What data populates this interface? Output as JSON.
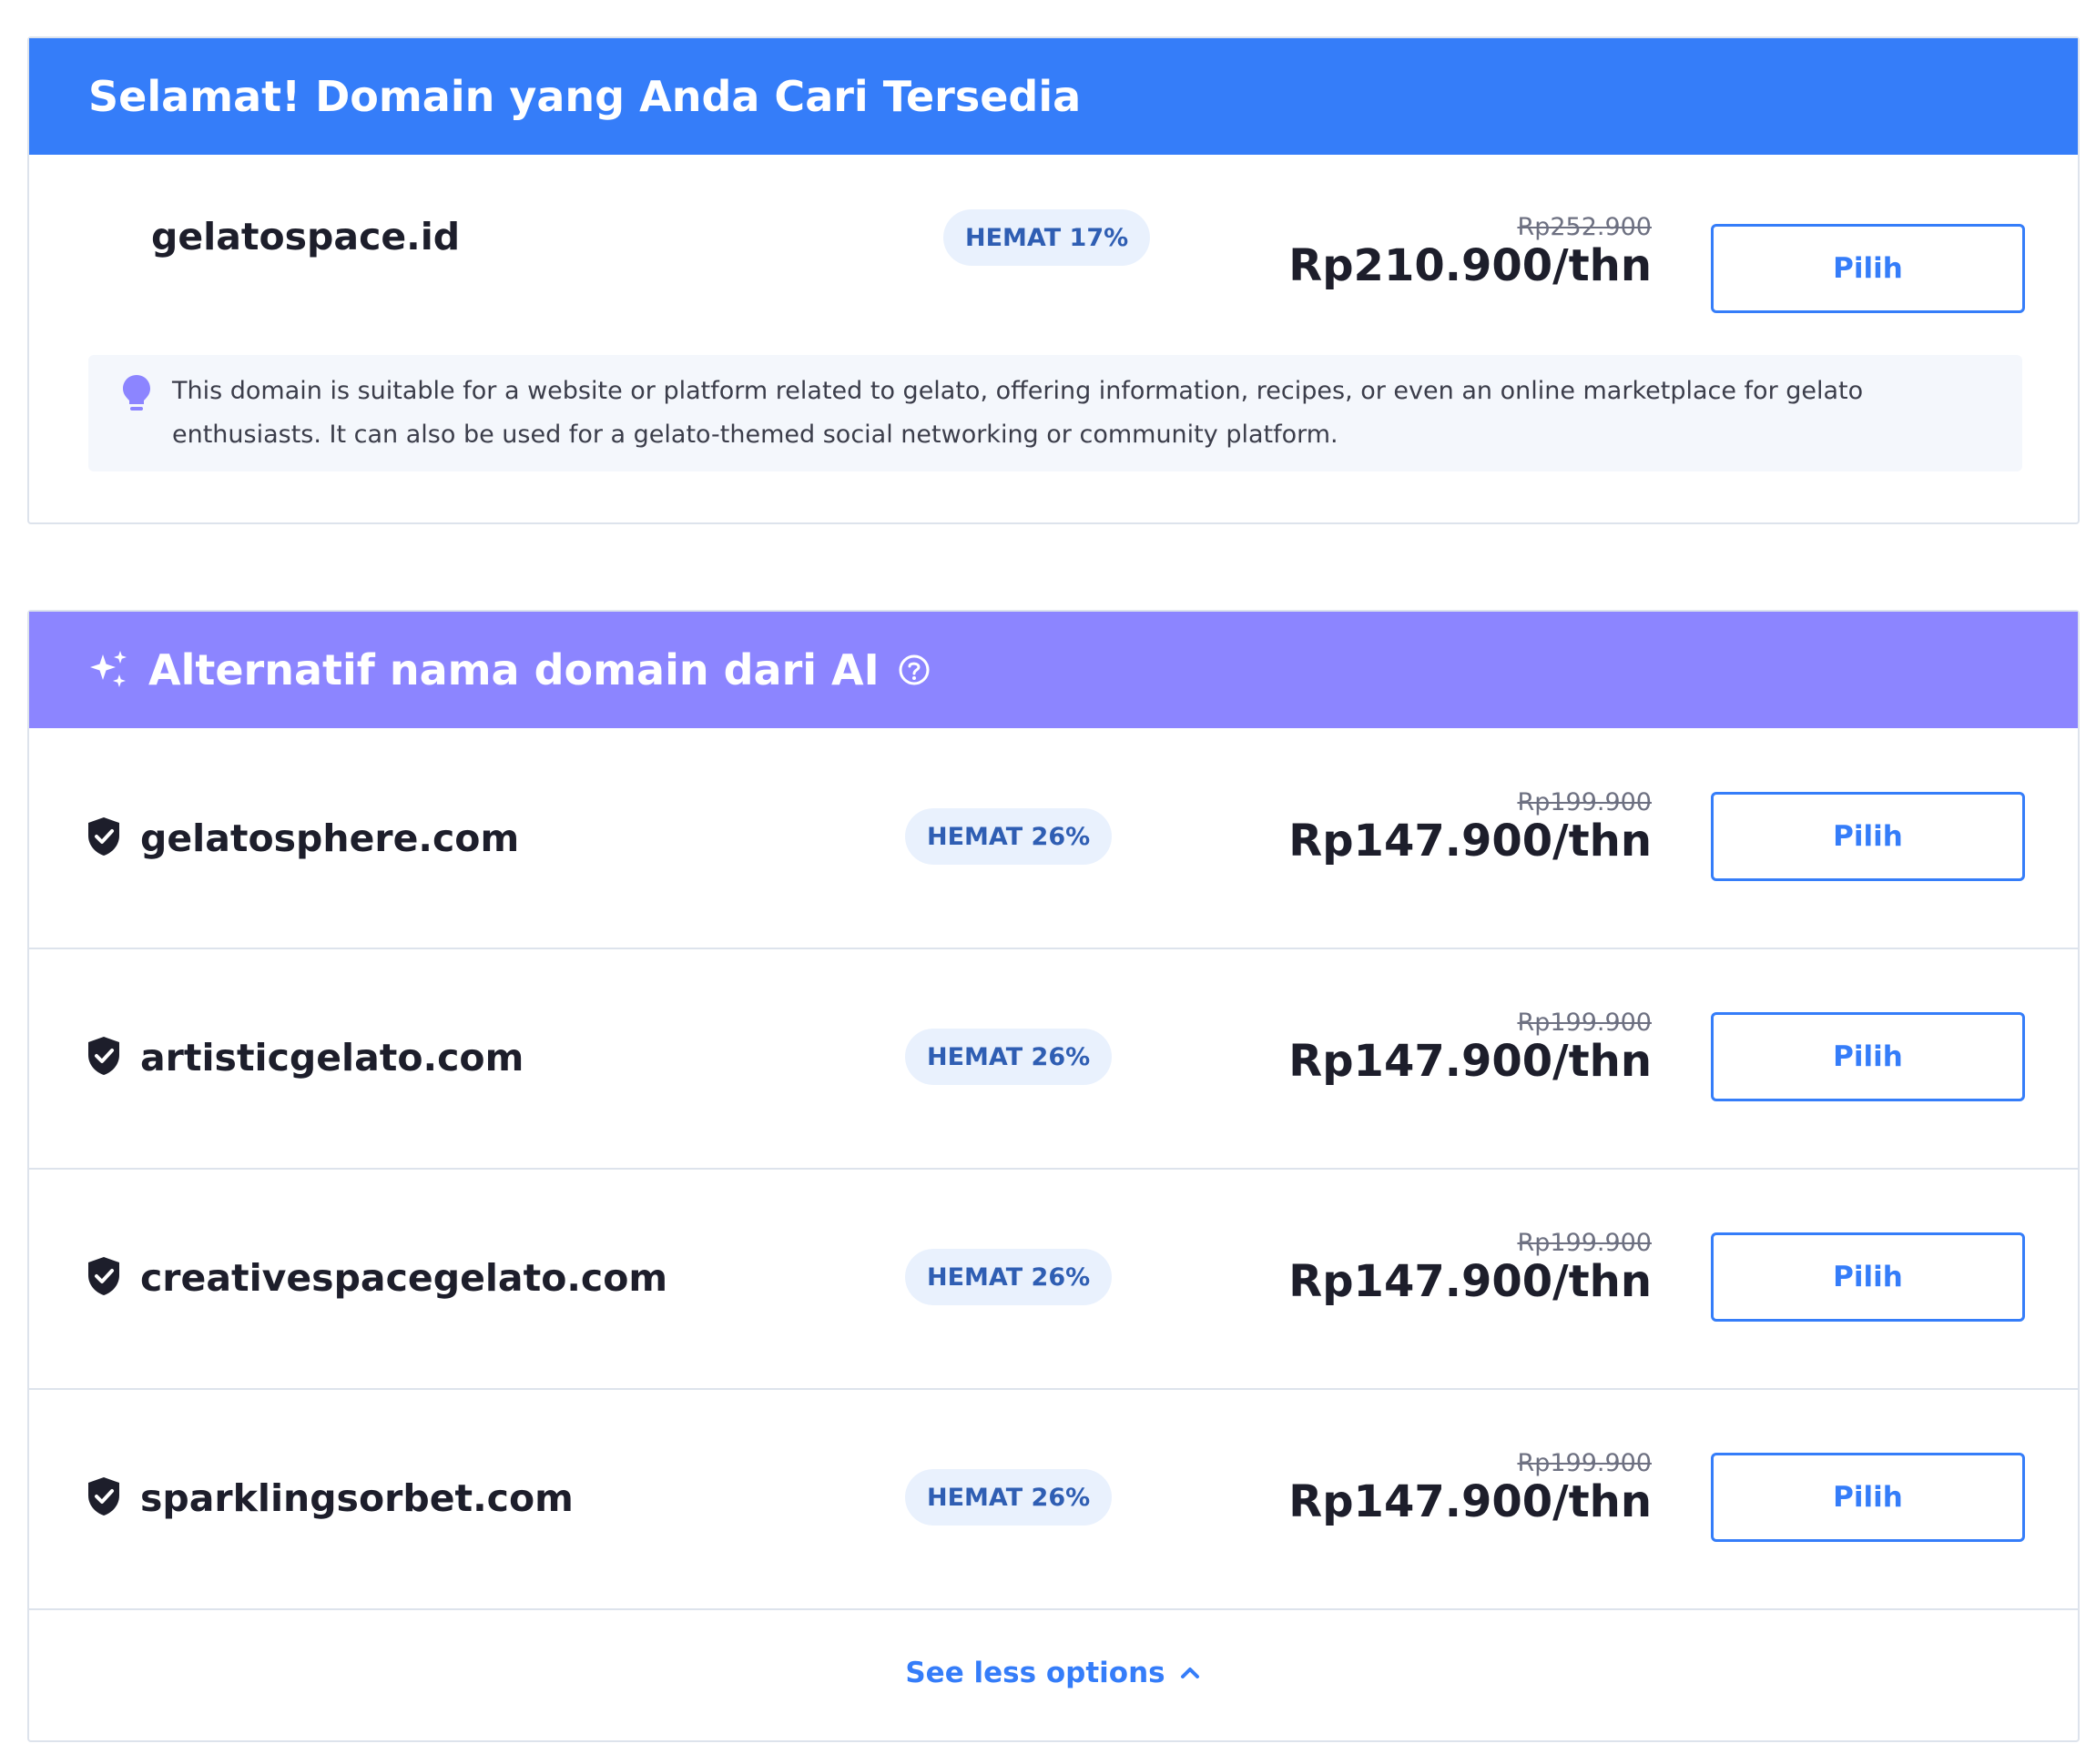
{
  "available": {
    "header": "Selamat! Domain yang Anda Cari Tersedia",
    "domain": "gelatospace.id",
    "badge": "HEMAT 17%",
    "old_price": "Rp252.900",
    "price": "Rp210.900/thn",
    "button": "Pilih",
    "description": "This domain is suitable for a website or platform related to gelato, offering information, recipes, or even an online marketplace for gelato enthusiasts. It can also be used for a gelato-themed social networking or community platform.",
    "icon": "lightbulb-icon"
  },
  "alternatives": {
    "header": "Alternatif nama domain dari AI",
    "header_icon": "sparkles-icon",
    "help_icon": "question-circle-icon",
    "items": [
      {
        "domain": "gelatosphere.com",
        "badge": "HEMAT 26%",
        "old_price": "Rp199.900",
        "price": "Rp147.900/thn",
        "button": "Pilih",
        "icon": "shield-check-icon"
      },
      {
        "domain": "artisticgelato.com",
        "badge": "HEMAT 26%",
        "old_price": "Rp199.900",
        "price": "Rp147.900/thn",
        "button": "Pilih",
        "icon": "shield-check-icon"
      },
      {
        "domain": "creativespacegelato.com",
        "badge": "HEMAT 26%",
        "old_price": "Rp199.900",
        "price": "Rp147.900/thn",
        "button": "Pilih",
        "icon": "shield-check-icon"
      },
      {
        "domain": "sparklingsorbet.com",
        "badge": "HEMAT 26%",
        "old_price": "Rp199.900",
        "price": "Rp147.900/thn",
        "button": "Pilih",
        "icon": "shield-check-icon"
      }
    ],
    "see_less": "See less options",
    "see_less_icon": "chevron-up-icon"
  },
  "colors": {
    "primary": "#357df9",
    "ai_header": "#8c85ff",
    "badge_bg": "#e9f1fd",
    "badge_text": "#2f5eb3",
    "text_dark": "#1d1e2b"
  }
}
